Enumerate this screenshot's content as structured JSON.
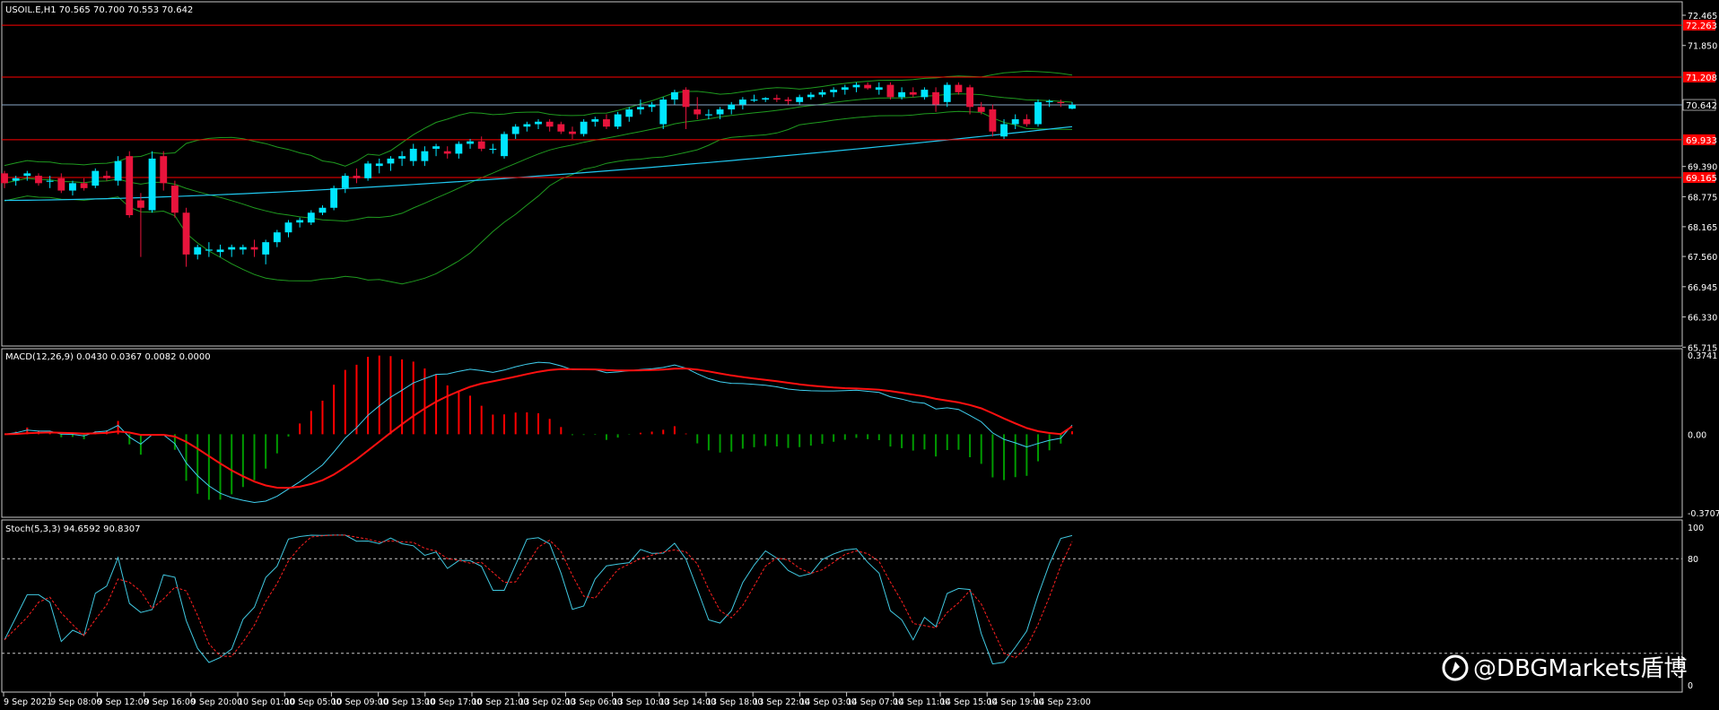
{
  "colors": {
    "background": "#000000",
    "frame": "#c8c8c8",
    "bull_candle": "#00e5ff",
    "bear_candle": "#e8143c",
    "level_line": "#ff0000",
    "bid_line": "#8aa8c8",
    "bollinger": "#1f9a1f",
    "ma": "#20c8f0",
    "macd_line": "#40d0f0",
    "macd_signal": "#ff1010",
    "hist_pos": "#ff0000",
    "hist_neg": "#009a00",
    "stoch_main": "#40c8e0",
    "stoch_signal": "#ff2020"
  },
  "main_panel": {
    "header": "USOIL.E,H1  70.565 70.700 70.553 70.642",
    "price_ticks": [
      "72.465",
      "71.850",
      "69.390",
      "68.775",
      "68.165",
      "67.560",
      "66.945",
      "66.330",
      "65.715"
    ],
    "bid_tag": "70.642",
    "level_tags": [
      "72.263",
      "71.208",
      "69.933",
      "69.165"
    ]
  },
  "macd_panel": {
    "header": "MACD(12,26,9) 0.0430 0.0367 0.0082 0.0000",
    "ticks": [
      "0.3741",
      "0.00",
      "-0.3707"
    ]
  },
  "stoch_panel": {
    "header": "Stoch(5,3,3) 94.6592 90.8307",
    "ticks": [
      "100",
      "80",
      "0"
    ]
  },
  "time_axis": [
    "9 Sep 2021",
    "9 Sep 08:00",
    "9 Sep 12:00",
    "9 Sep 16:00",
    "9 Sep 20:00",
    "10 Sep 01:00",
    "10 Sep 05:00",
    "10 Sep 09:00",
    "10 Sep 13:00",
    "10 Sep 17:00",
    "10 Sep 21:00",
    "13 Sep 02:00",
    "13 Sep 06:00",
    "13 Sep 10:00",
    "13 Sep 14:00",
    "13 Sep 18:00",
    "13 Sep 22:00",
    "14 Sep 03:00",
    "14 Sep 07:00",
    "14 Sep 11:00",
    "14 Sep 15:00",
    "14 Sep 19:00",
    "14 Sep 23:00"
  ],
  "watermark": "@DBGMarkets盾博",
  "chart_data": {
    "type": "candlestick",
    "symbol": "USOIL.E",
    "timeframe": "H1",
    "ohlc_last": {
      "open": 70.565,
      "high": 70.7,
      "low": 70.553,
      "close": 70.642
    },
    "levels": [
      72.263,
      71.208,
      69.933,
      69.165
    ],
    "bid": 70.642,
    "candles": [
      [
        69.25,
        69.3,
        68.95,
        69.05
      ],
      [
        69.1,
        69.2,
        69.0,
        69.15
      ],
      [
        69.2,
        69.3,
        69.1,
        69.25
      ],
      [
        69.2,
        69.25,
        69.0,
        69.05
      ],
      [
        69.1,
        69.2,
        68.95,
        69.1
      ],
      [
        69.15,
        69.25,
        68.85,
        68.9
      ],
      [
        68.9,
        69.1,
        68.8,
        69.05
      ],
      [
        69.05,
        69.15,
        68.9,
        68.95
      ],
      [
        69.0,
        69.35,
        68.95,
        69.3
      ],
      [
        69.2,
        69.3,
        69.1,
        69.15
      ],
      [
        69.1,
        69.6,
        69.0,
        69.5
      ],
      [
        69.6,
        69.7,
        68.35,
        68.4
      ],
      [
        68.7,
        68.85,
        67.55,
        68.55
      ],
      [
        68.5,
        69.7,
        68.45,
        69.55
      ],
      [
        69.6,
        69.7,
        68.9,
        69.05
      ],
      [
        69.0,
        69.1,
        68.35,
        68.45
      ],
      [
        68.45,
        68.55,
        67.35,
        67.6
      ],
      [
        67.6,
        67.8,
        67.5,
        67.75
      ],
      [
        67.7,
        67.85,
        67.55,
        67.7
      ],
      [
        67.65,
        67.8,
        67.55,
        67.7
      ],
      [
        67.7,
        67.8,
        67.55,
        67.75
      ],
      [
        67.7,
        67.8,
        67.6,
        67.75
      ],
      [
        67.75,
        67.9,
        67.55,
        67.7
      ],
      [
        67.6,
        67.9,
        67.4,
        67.85
      ],
      [
        67.85,
        68.1,
        67.75,
        68.05
      ],
      [
        68.05,
        68.3,
        67.95,
        68.25
      ],
      [
        68.25,
        68.35,
        68.15,
        68.3
      ],
      [
        68.25,
        68.5,
        68.2,
        68.45
      ],
      [
        68.45,
        68.6,
        68.4,
        68.55
      ],
      [
        68.55,
        69.0,
        68.5,
        68.95
      ],
      [
        68.95,
        69.25,
        68.85,
        69.2
      ],
      [
        69.2,
        69.35,
        69.05,
        69.15
      ],
      [
        69.15,
        69.5,
        69.1,
        69.45
      ],
      [
        69.4,
        69.55,
        69.25,
        69.45
      ],
      [
        69.45,
        69.6,
        69.3,
        69.55
      ],
      [
        69.55,
        69.7,
        69.4,
        69.6
      ],
      [
        69.5,
        69.85,
        69.4,
        69.75
      ],
      [
        69.5,
        69.8,
        69.4,
        69.7
      ],
      [
        69.75,
        69.85,
        69.6,
        69.8
      ],
      [
        69.7,
        69.8,
        69.55,
        69.65
      ],
      [
        69.65,
        69.9,
        69.55,
        69.85
      ],
      [
        69.85,
        69.95,
        69.75,
        69.9
      ],
      [
        69.9,
        70.0,
        69.7,
        69.75
      ],
      [
        69.75,
        69.85,
        69.65,
        69.75
      ],
      [
        69.6,
        70.1,
        69.55,
        70.05
      ],
      [
        70.05,
        70.25,
        69.95,
        70.2
      ],
      [
        70.2,
        70.3,
        70.1,
        70.25
      ],
      [
        70.25,
        70.35,
        70.15,
        70.3
      ],
      [
        70.3,
        70.35,
        70.1,
        70.2
      ],
      [
        70.25,
        70.3,
        70.05,
        70.1
      ],
      [
        70.1,
        70.2,
        69.95,
        70.05
      ],
      [
        70.05,
        70.35,
        70.0,
        70.3
      ],
      [
        70.3,
        70.4,
        70.2,
        70.35
      ],
      [
        70.35,
        70.45,
        70.15,
        70.2
      ],
      [
        70.2,
        70.5,
        70.15,
        70.45
      ],
      [
        70.4,
        70.6,
        70.3,
        70.55
      ],
      [
        70.55,
        70.75,
        70.45,
        70.6
      ],
      [
        70.6,
        70.7,
        70.5,
        70.65
      ],
      [
        70.25,
        70.8,
        70.15,
        70.75
      ],
      [
        70.75,
        70.95,
        70.65,
        70.9
      ],
      [
        70.95,
        71.0,
        70.15,
        70.6
      ],
      [
        70.55,
        70.8,
        70.35,
        70.45
      ],
      [
        70.45,
        70.55,
        70.35,
        70.45
      ],
      [
        70.45,
        70.6,
        70.35,
        70.55
      ],
      [
        70.55,
        70.7,
        70.45,
        70.65
      ],
      [
        70.65,
        70.8,
        70.55,
        70.75
      ],
      [
        70.75,
        70.85,
        70.7,
        70.75
      ],
      [
        70.75,
        70.8,
        70.7,
        70.78
      ],
      [
        70.78,
        70.85,
        70.7,
        70.75
      ],
      [
        70.75,
        70.8,
        70.65,
        70.72
      ],
      [
        70.7,
        70.85,
        70.65,
        70.8
      ],
      [
        70.8,
        70.9,
        70.75,
        70.85
      ],
      [
        70.85,
        70.95,
        70.8,
        70.9
      ],
      [
        70.9,
        71.0,
        70.8,
        70.95
      ],
      [
        70.95,
        71.05,
        70.85,
        71.0
      ],
      [
        71.0,
        71.1,
        70.9,
        71.05
      ],
      [
        71.05,
        71.1,
        70.95,
        70.98
      ],
      [
        70.95,
        71.1,
        70.85,
        71.0
      ],
      [
        71.05,
        71.1,
        70.75,
        70.8
      ],
      [
        70.8,
        71.0,
        70.75,
        70.9
      ],
      [
        70.9,
        71.0,
        70.8,
        70.85
      ],
      [
        70.8,
        71.0,
        70.75,
        70.95
      ],
      [
        70.9,
        71.0,
        70.5,
        70.65
      ],
      [
        70.7,
        71.1,
        70.6,
        71.05
      ],
      [
        71.05,
        71.1,
        70.85,
        70.9
      ],
      [
        71.0,
        71.05,
        70.45,
        70.6
      ],
      [
        70.6,
        70.7,
        70.45,
        70.5
      ],
      [
        70.55,
        70.65,
        70.0,
        70.1
      ],
      [
        70.0,
        70.35,
        69.95,
        70.25
      ],
      [
        70.25,
        70.45,
        70.15,
        70.35
      ],
      [
        70.35,
        70.45,
        70.2,
        70.25
      ],
      [
        70.25,
        70.75,
        70.2,
        70.7
      ],
      [
        70.7,
        70.75,
        70.6,
        70.72
      ],
      [
        70.7,
        70.75,
        70.6,
        70.68
      ],
      [
        70.565,
        70.7,
        70.553,
        70.642
      ]
    ],
    "ma": [
      68.7,
      70.2
    ],
    "bollinger_upper_min": 69.3,
    "macd": {
      "params": [
        12,
        26,
        9
      ],
      "main": 0.043,
      "signal": 0.0367,
      "histogram": 0.0082,
      "ylim": [
        -0.3707,
        0.3741
      ]
    },
    "stochastic": {
      "params": [
        5,
        3,
        3
      ],
      "k": 94.6592,
      "d": 90.8307,
      "levels": [
        80,
        20
      ],
      "ylim": [
        0,
        100
      ]
    }
  }
}
